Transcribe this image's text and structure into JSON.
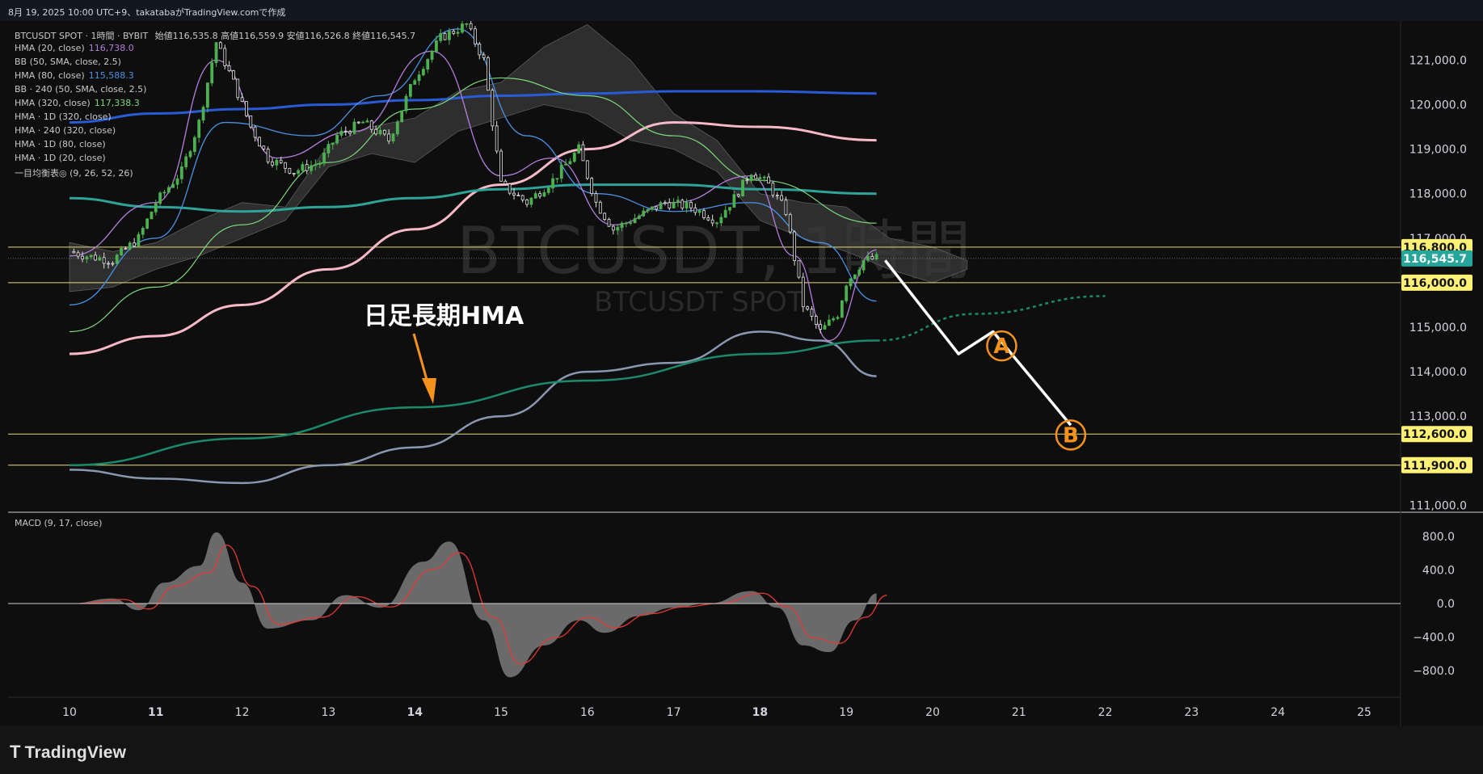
{
  "header": {
    "caption": "8月 19, 2025 10:00 UTC+9、takatabaがTradingView.comで作成"
  },
  "legend": {
    "title_line": {
      "text": "BTCUSDT SPOT · 1時間 · BYBIT",
      "ohlc": "始値116,535.8 高値116,559.9 安値116,526.8 終値116,545.7"
    },
    "rows": [
      {
        "label": "HMA (20, close)",
        "value": "116,738.0",
        "color": "#b57edc"
      },
      {
        "label": "BB (50, SMA, close, 2.5)",
        "value": "",
        "color": "#c8c8c8"
      },
      {
        "label": "HMA (80, close)",
        "value": "115,588.3",
        "color": "#4a90e2"
      },
      {
        "label": "BB · 240 (50, SMA, close, 2.5)",
        "value": "",
        "color": "#c8c8c8"
      },
      {
        "label": "HMA (320, close)",
        "value": "117,338.3",
        "color": "#7cd97c"
      },
      {
        "label": "HMA · 1D (320, close)",
        "value": "",
        "color": "#c8c8c8"
      },
      {
        "label": "HMA · 240 (320, close)",
        "value": "",
        "color": "#c8c8c8"
      },
      {
        "label": "HMA · 1D (80, close)",
        "value": "",
        "color": "#c8c8c8"
      },
      {
        "label": "HMA · 1D (20, close)",
        "value": "",
        "color": "#c8c8c8"
      },
      {
        "label": "一目均衡表◎ (9, 26, 52, 26)",
        "value": "",
        "color": "#c8c8c8"
      }
    ]
  },
  "watermark": {
    "main": "BTCUSDT, 1時間",
    "sub": "BTCUSDT SPOT"
  },
  "annotation": {
    "label": "日足長期HMA",
    "wave_a": "A",
    "wave_b": "B"
  },
  "price_axis": {
    "ticks": [
      "121,000.0",
      "120,000.0",
      "119,000.0",
      "118,000.0",
      "117,000.0",
      "115,000.0",
      "114,000.0",
      "113,000.0",
      "111,000.0"
    ],
    "badges": [
      {
        "text": "116,800.0",
        "color": "#fff176"
      },
      {
        "text": "116,545.7",
        "color": "#26a69a"
      },
      {
        "text": "116,000.0",
        "color": "#fff176"
      },
      {
        "text": "112,600.0",
        "color": "#fff176"
      },
      {
        "text": "111,900.0",
        "color": "#fff176"
      }
    ]
  },
  "macd": {
    "label": "MACD (9, 17, close)",
    "ticks": [
      "800.0",
      "400.0",
      "0.0",
      "−400.0",
      "−800.0"
    ]
  },
  "time_axis": {
    "labels": [
      "10",
      "11",
      "12",
      "13",
      "14",
      "15",
      "16",
      "17",
      "18",
      "19",
      "20",
      "21",
      "22",
      "23",
      "24",
      "25"
    ],
    "bold": [
      "11",
      "14",
      "18"
    ]
  },
  "brand": {
    "name": "TradingView"
  },
  "chart_data": {
    "type": "line",
    "title": "BTCUSDT, 1時間",
    "ylim": [
      110800,
      121800
    ],
    "x_days": [
      10,
      11,
      12,
      13,
      14,
      15,
      16,
      17,
      18,
      19,
      20,
      21,
      22,
      23,
      24,
      25
    ],
    "horizontal_levels": [
      116800,
      116545.7,
      116000,
      112600,
      111900
    ],
    "series": [
      {
        "name": "close",
        "points": [
          [
            10.0,
            116700
          ],
          [
            10.2,
            116600
          ],
          [
            10.5,
            116500
          ],
          [
            10.8,
            117000
          ],
          [
            11.0,
            117800
          ],
          [
            11.3,
            118500
          ],
          [
            11.5,
            119600
          ],
          [
            11.7,
            121400
          ],
          [
            11.9,
            120500
          ],
          [
            12.1,
            119500
          ],
          [
            12.3,
            118800
          ],
          [
            12.6,
            118500
          ],
          [
            12.9,
            118700
          ],
          [
            13.1,
            119300
          ],
          [
            13.4,
            119600
          ],
          [
            13.7,
            119200
          ],
          [
            14.0,
            120600
          ],
          [
            14.3,
            121500
          ],
          [
            14.6,
            121800
          ],
          [
            14.8,
            121000
          ],
          [
            15.0,
            118200
          ],
          [
            15.3,
            117800
          ],
          [
            15.6,
            118300
          ],
          [
            15.9,
            119000
          ],
          [
            16.1,
            117800
          ],
          [
            16.3,
            117200
          ],
          [
            16.6,
            117500
          ],
          [
            16.9,
            117800
          ],
          [
            17.2,
            117700
          ],
          [
            17.5,
            117400
          ],
          [
            17.7,
            117900
          ],
          [
            17.9,
            118500
          ],
          [
            18.1,
            118200
          ],
          [
            18.3,
            117600
          ],
          [
            18.5,
            115500
          ],
          [
            18.7,
            114900
          ],
          [
            18.9,
            115300
          ],
          [
            19.0,
            116000
          ],
          [
            19.2,
            116500
          ],
          [
            19.35,
            116545
          ]
        ]
      },
      {
        "name": "HMA (20, close)",
        "points": [
          [
            10.0,
            116600
          ],
          [
            11.0,
            117800
          ],
          [
            11.7,
            121000
          ],
          [
            12.4,
            118800
          ],
          [
            13.3,
            119400
          ],
          [
            14.2,
            121200
          ],
          [
            15.0,
            118400
          ],
          [
            15.6,
            118800
          ],
          [
            16.3,
            117300
          ],
          [
            17.0,
            117800
          ],
          [
            17.9,
            118400
          ],
          [
            18.4,
            116600
          ],
          [
            18.8,
            114700
          ],
          [
            19.35,
            116738
          ]
        ]
      },
      {
        "name": "HMA (80, close)",
        "points": [
          [
            10.0,
            115500
          ],
          [
            11.0,
            117000
          ],
          [
            11.8,
            119600
          ],
          [
            12.8,
            119300
          ],
          [
            13.6,
            120200
          ],
          [
            14.5,
            121700
          ],
          [
            15.3,
            119300
          ],
          [
            16.1,
            118000
          ],
          [
            17.0,
            117600
          ],
          [
            17.9,
            117800
          ],
          [
            18.7,
            116900
          ],
          [
            19.35,
            115588
          ]
        ]
      },
      {
        "name": "HMA (320, close)",
        "points": [
          [
            10.0,
            114900
          ],
          [
            11.0,
            115900
          ],
          [
            12.0,
            117300
          ],
          [
            13.0,
            118700
          ],
          [
            14.0,
            119900
          ],
          [
            15.0,
            120600
          ],
          [
            16.0,
            120200
          ],
          [
            17.0,
            119300
          ],
          [
            18.0,
            118300
          ],
          [
            19.35,
            117338
          ]
        ]
      },
      {
        "name": "HMA · 240 (320, close)",
        "points": [
          [
            10.0,
            117900
          ],
          [
            11.0,
            117700
          ],
          [
            12.0,
            117600
          ],
          [
            13.0,
            117700
          ],
          [
            14.0,
            117900
          ],
          [
            15.0,
            118100
          ],
          [
            16.0,
            118200
          ],
          [
            17.0,
            118200
          ],
          [
            18.0,
            118100
          ],
          [
            19.35,
            118000
          ]
        ]
      },
      {
        "name": "HMA · 1D (320, close)",
        "points": [
          [
            10.0,
            119600
          ],
          [
            11.0,
            119800
          ],
          [
            12.0,
            119900
          ],
          [
            13.0,
            120000
          ],
          [
            14.0,
            120100
          ],
          [
            15.0,
            120200
          ],
          [
            16.0,
            120250
          ],
          [
            17.0,
            120300
          ],
          [
            18.0,
            120300
          ],
          [
            19.35,
            120250
          ]
        ]
      },
      {
        "name": "HMA · 1D (80, close)",
        "points": [
          [
            10.0,
            114400
          ],
          [
            11.0,
            114800
          ],
          [
            12.0,
            115500
          ],
          [
            13.0,
            116300
          ],
          [
            14.0,
            117200
          ],
          [
            15.0,
            118200
          ],
          [
            16.0,
            119000
          ],
          [
            17.0,
            119600
          ],
          [
            18.0,
            119500
          ],
          [
            19.35,
            119200
          ]
        ]
      },
      {
        "name": "HMA · 1D (20, close)",
        "points": [
          [
            10.0,
            111800
          ],
          [
            11.0,
            111600
          ],
          [
            12.0,
            111500
          ],
          [
            13.0,
            111900
          ],
          [
            14.0,
            112300
          ],
          [
            15.0,
            113000
          ],
          [
            16.0,
            114000
          ],
          [
            17.0,
            114200
          ],
          [
            18.0,
            114900
          ],
          [
            18.7,
            114700
          ],
          [
            19.35,
            113900
          ]
        ]
      },
      {
        "name": "日足長期HMA",
        "points": [
          [
            10.0,
            111900
          ],
          [
            12.0,
            112500
          ],
          [
            14.0,
            113200
          ],
          [
            16.0,
            113800
          ],
          [
            18.0,
            114400
          ],
          [
            19.35,
            114700
          ]
        ]
      },
      {
        "name": "日足長期HMA projection",
        "points": [
          [
            19.35,
            114700
          ],
          [
            20.5,
            115300
          ],
          [
            22.0,
            115700
          ]
        ]
      },
      {
        "name": "forecast",
        "points": [
          [
            19.45,
            116500
          ],
          [
            20.3,
            114400
          ],
          [
            20.7,
            114900
          ],
          [
            21.6,
            112800
          ]
        ]
      }
    ],
    "macd": {
      "ylim": [
        -1000,
        1050
      ],
      "points": [
        [
          10.0,
          0
        ],
        [
          10.5,
          60
        ],
        [
          10.8,
          -80
        ],
        [
          11.1,
          250
        ],
        [
          11.5,
          450
        ],
        [
          11.7,
          850
        ],
        [
          12.0,
          250
        ],
        [
          12.3,
          -300
        ],
        [
          12.8,
          -200
        ],
        [
          13.2,
          100
        ],
        [
          13.6,
          -50
        ],
        [
          14.1,
          500
        ],
        [
          14.4,
          740
        ],
        [
          14.8,
          -200
        ],
        [
          15.1,
          -880
        ],
        [
          15.5,
          -500
        ],
        [
          15.9,
          -200
        ],
        [
          16.2,
          -350
        ],
        [
          16.6,
          -150
        ],
        [
          17.0,
          -50
        ],
        [
          17.4,
          0
        ],
        [
          17.9,
          150
        ],
        [
          18.2,
          -50
        ],
        [
          18.5,
          -500
        ],
        [
          18.8,
          -580
        ],
        [
          19.1,
          -200
        ],
        [
          19.35,
          120
        ]
      ]
    }
  }
}
